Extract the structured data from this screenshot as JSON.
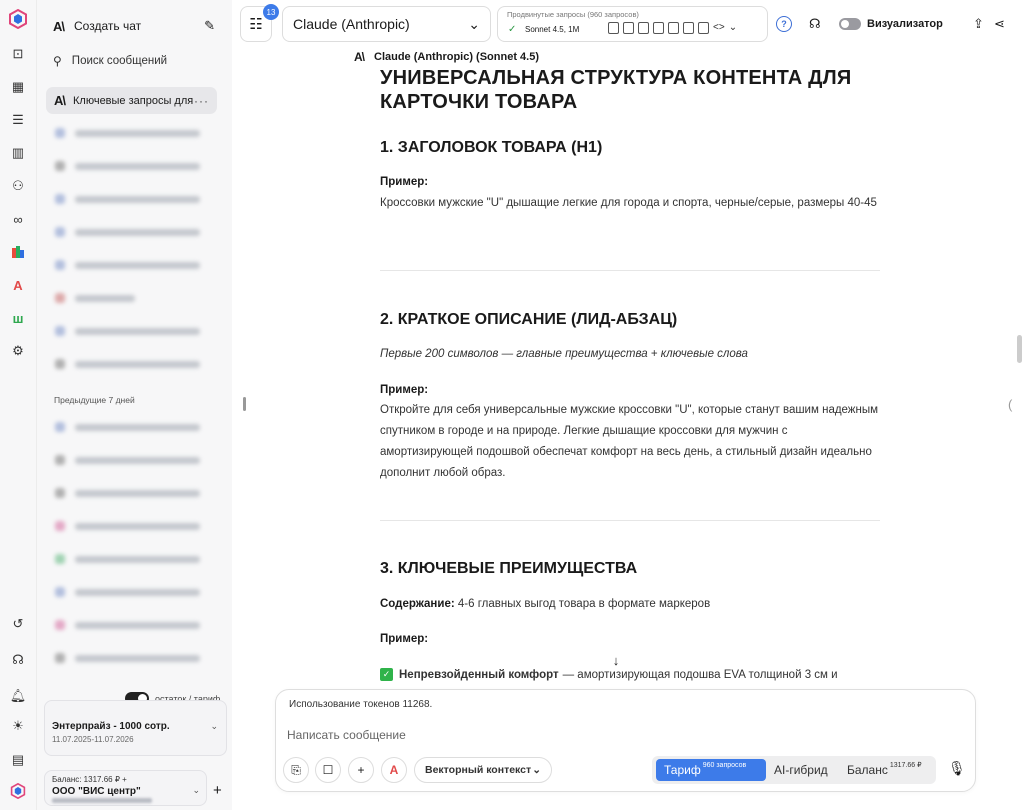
{
  "rail": {
    "icons": [
      "app-logo-icon",
      "terminal-icon",
      "table-icon",
      "list-icon",
      "building-icon",
      "users-icon",
      "infinity-icon",
      "colors-icon",
      "a-brand-icon",
      "w-brand-icon",
      "settings-icon",
      "history-icon",
      "headset-icon",
      "bell-icon",
      "sun-icon",
      "document-icon",
      "app-logo-small-icon"
    ]
  },
  "sidebar": {
    "new_chat": "Создать чат",
    "search_placeholder": "Поиск сообщений",
    "active_chat": "Ключевые запросы для",
    "section_previous": "Предыдущие 7 дней",
    "toggle_label": "остаток / тариф",
    "plan_name": "Энтерпрайз - 1000 сотр.",
    "plan_dates": "11.07.2025-11.07.2026",
    "balance_line": "Баланс: 1317.66 ₽ +",
    "org_name": "ООО \"ВИС центр\""
  },
  "topbar": {
    "badge_count": "13",
    "model_name": "Claude (Anthropic)",
    "advanced_label": "Продвинутые запросы (960 запросов)",
    "advanced_model": "Sonnet 4.5, 1M",
    "visualizer_label": "Визуализатор"
  },
  "content": {
    "model_line": "Claude (Anthropic) (Sonnet 4.5)",
    "title": "УНИВЕРСАЛЬНАЯ СТРУКТУРА КОНТЕНТА ДЛЯ КАРТОЧКИ ТОВАРА",
    "s1_title": "1. ЗАГОЛОВОК ТОВАРА (H1)",
    "s1_example_label": "Пример:",
    "s1_example": "Кроссовки мужские \"U\" дышащие легкие для города и спорта, черные/серые, размеры 40-45",
    "s2_title": "2. КРАТКОЕ ОПИСАНИЕ (ЛИД-АБЗАЦ)",
    "s2_note": "Первые 200 символов — главные преимущества + ключевые слова",
    "s2_example_label": "Пример:",
    "s2_example": "Откройте для себя универсальные мужские кроссовки \"U\", которые станут вашим надежным спутником в городе и на природе. Легкие дышащие кроссовки для мужчин с амортизирующей подошвой обеспечат комфорт на весь день, а стильный дизайн идеально дополнит любой образ.",
    "s3_title": "3. КЛЮЧЕВЫЕ ПРЕИМУЩЕСТВА",
    "s3_content_label": "Содержание:",
    "s3_content": "4-6 главных выгод товара в формате маркеров",
    "s3_example_label": "Пример:",
    "s3_bullet_bold": "Непревзойденный комфорт",
    "s3_bullet_text": "— амортизирующая подошва EVA толщиной 3 см и"
  },
  "composer": {
    "tokens": "Использование токенов 11268.",
    "placeholder": "Написать сообщение",
    "vector_context": "Векторный контекст",
    "seg_tariff": "Тариф",
    "seg_tariff_sup": "960 запросов",
    "seg_ai": "AI-гибрид",
    "seg_balance": "Баланс",
    "seg_balance_sup": "1317.66 ₽"
  },
  "colors": {
    "accent": "#3d7be9",
    "success": "#2fb34a",
    "sidebar_bg": "#f7f7f8"
  }
}
